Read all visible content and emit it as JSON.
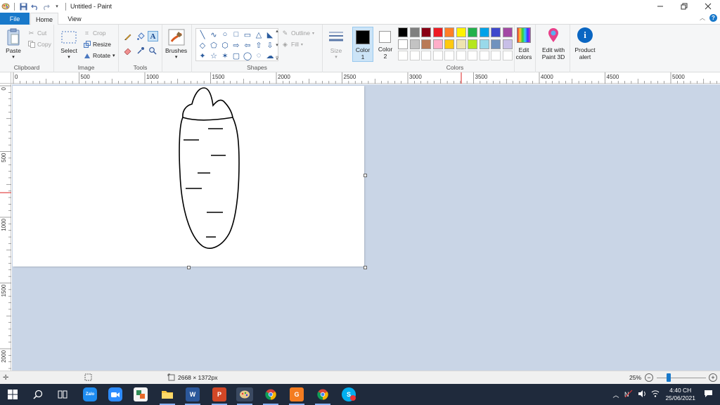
{
  "window": {
    "title": "Untitled - Paint"
  },
  "tabs": {
    "file": "File",
    "home": "Home",
    "view": "View"
  },
  "ribbon": {
    "clipboard": {
      "label": "Clipboard",
      "paste": "Paste",
      "cut": "Cut",
      "copy": "Copy"
    },
    "image": {
      "label": "Image",
      "select": "Select",
      "crop": "Crop",
      "resize": "Resize",
      "rotate": "Rotate"
    },
    "tools": {
      "label": "Tools"
    },
    "brushes": {
      "label": "Brushes"
    },
    "shapes": {
      "label": "Shapes",
      "outline": "Outline",
      "fill": "Fill"
    },
    "size": {
      "label": "Size"
    },
    "color1": {
      "line1": "Color",
      "line2": "1"
    },
    "color2": {
      "line1": "Color",
      "line2": "2"
    },
    "colors": {
      "label": "Colors",
      "row1": [
        "#000000",
        "#7f7f7f",
        "#880015",
        "#ed1c24",
        "#ff7f27",
        "#fff200",
        "#22b14c",
        "#00a2e8",
        "#3f48cc",
        "#a349a4"
      ],
      "row2": [
        "#ffffff",
        "#c3c3c3",
        "#b97a57",
        "#ffaec9",
        "#ffc90e",
        "#efe4b0",
        "#b5e61d",
        "#99d9ea",
        "#7092be",
        "#c8bfe7"
      ],
      "row3": [
        "#ffffff",
        "#ffffff",
        "#ffffff",
        "#ffffff",
        "#ffffff",
        "#ffffff",
        "#ffffff",
        "#ffffff",
        "#ffffff",
        "#ffffff"
      ]
    },
    "edit_colors": {
      "line1": "Edit",
      "line2": "colors"
    },
    "edit_paint3d": {
      "line1": "Edit with",
      "line2": "Paint 3D"
    },
    "product_alert": {
      "line1": "Product",
      "line2": "alert"
    }
  },
  "ruler": {
    "h_ticks": [
      "0",
      "500",
      "1000",
      "1500",
      "2000",
      "2500",
      "3000",
      "3500",
      "4000",
      "4500",
      "5000"
    ],
    "v_ticks": [
      "0",
      "500",
      "1000",
      "1500",
      "2000"
    ]
  },
  "status": {
    "dimensions": "2668 × 1372px",
    "zoom": "25%",
    "zoom_fraction": 0.25
  },
  "taskbar": {
    "time": "4:40 CH",
    "date": "25/06/2021",
    "apps": [
      "start",
      "search",
      "task-view",
      "zalo",
      "zoom",
      "teams",
      "file-explorer",
      "word",
      "powerpoint",
      "paint",
      "chrome",
      "origin",
      "chrome-alt",
      "skype"
    ]
  }
}
